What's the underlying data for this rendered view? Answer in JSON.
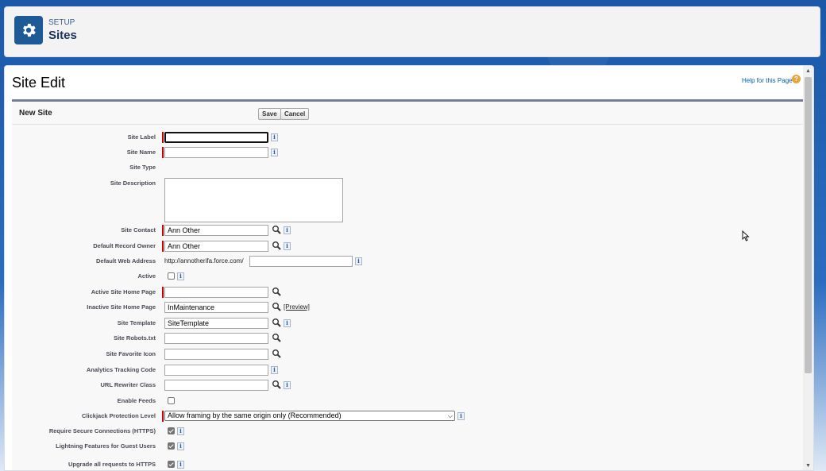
{
  "header": {
    "breadcrumb": "SETUP",
    "title": "Sites"
  },
  "page": {
    "title": "Site Edit",
    "help_link": "Help for this Page",
    "help_icon": "?"
  },
  "block": {
    "title": "New Site",
    "save_label": "Save",
    "cancel_label": "Cancel"
  },
  "info_glyph": "i",
  "fields": {
    "site_label": {
      "label": "Site Label",
      "value": ""
    },
    "site_name": {
      "label": "Site Name",
      "value": ""
    },
    "site_type": {
      "label": "Site Type"
    },
    "site_description": {
      "label": "Site Description",
      "value": ""
    },
    "site_contact": {
      "label": "Site Contact",
      "value": "Ann Other"
    },
    "default_record_owner": {
      "label": "Default Record Owner",
      "value": "Ann Other"
    },
    "default_web_address": {
      "label": "Default Web Address",
      "prefix": "http://annotherifa.force.com/",
      "value": ""
    },
    "active": {
      "label": "Active",
      "checked": false
    },
    "active_home_page": {
      "label": "Active Site Home Page",
      "value": ""
    },
    "inactive_home_page": {
      "label": "Inactive Site Home Page",
      "value": "InMaintenance",
      "preview": "[Preview]"
    },
    "site_template": {
      "label": "Site Template",
      "value": "SiteTemplate"
    },
    "robots_txt": {
      "label": "Site Robots.txt",
      "value": ""
    },
    "favorite_icon": {
      "label": "Site Favorite Icon",
      "value": ""
    },
    "analytics_code": {
      "label": "Analytics Tracking Code",
      "value": ""
    },
    "url_rewriter": {
      "label": "URL Rewriter Class",
      "value": ""
    },
    "enable_feeds": {
      "label": "Enable Feeds",
      "checked": false
    },
    "clickjack": {
      "label": "Clickjack Protection Level",
      "value": "Allow framing by the same origin only (Recommended)"
    },
    "require_https": {
      "label": "Require Secure Connections (HTTPS)",
      "checked": true
    },
    "lightning_guest": {
      "label": "Lightning Features for Guest Users",
      "checked": true
    },
    "upgrade_https": {
      "label": "Upgrade all requests to HTTPS",
      "checked": true
    }
  },
  "colors": {
    "required_marker": "#cc0000",
    "header_icon_bg": "#1e5a96",
    "block_border": "#747e96"
  }
}
